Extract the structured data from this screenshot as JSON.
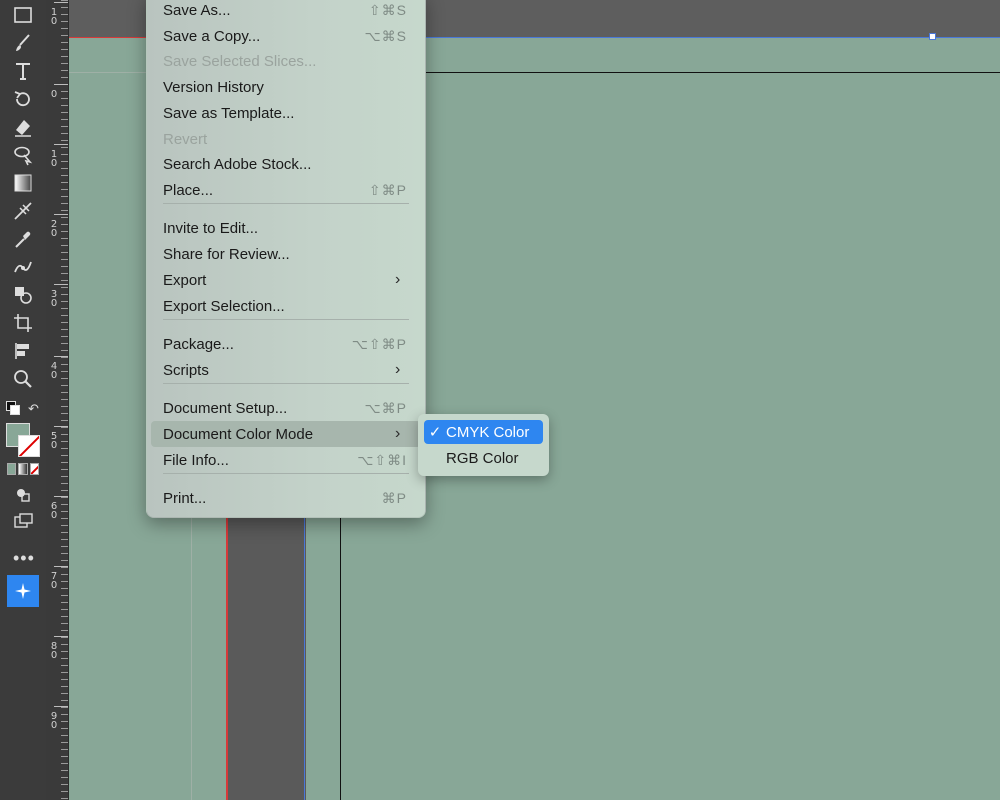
{
  "menu": {
    "items": [
      {
        "label": "Save As...",
        "shortcut": "⇧⌘S",
        "disabled": false,
        "submenu": false
      },
      {
        "label": "Save a Copy...",
        "shortcut": "⌥⌘S",
        "disabled": false,
        "submenu": false
      },
      {
        "label": "Save Selected Slices...",
        "shortcut": "",
        "disabled": true,
        "submenu": false
      },
      {
        "label": "Version History",
        "shortcut": "",
        "disabled": false,
        "submenu": false
      },
      {
        "label": "Save as Template...",
        "shortcut": "",
        "disabled": false,
        "submenu": false
      },
      {
        "label": "Revert",
        "shortcut": "",
        "disabled": true,
        "submenu": false
      },
      {
        "label": "Search Adobe Stock...",
        "shortcut": "",
        "disabled": false,
        "submenu": false
      },
      {
        "label": "Place...",
        "shortcut": "⇧⌘P",
        "disabled": false,
        "submenu": false
      },
      {
        "label": "Invite to Edit...",
        "shortcut": "",
        "disabled": false,
        "submenu": false
      },
      {
        "label": "Share for Review...",
        "shortcut": "",
        "disabled": false,
        "submenu": false
      },
      {
        "label": "Export",
        "shortcut": "",
        "disabled": false,
        "submenu": true
      },
      {
        "label": "Export Selection...",
        "shortcut": "",
        "disabled": false,
        "submenu": false
      },
      {
        "label": "Package...",
        "shortcut": "⌥⇧⌘P",
        "disabled": false,
        "submenu": false
      },
      {
        "label": "Scripts",
        "shortcut": "",
        "disabled": false,
        "submenu": true
      },
      {
        "label": "Document Setup...",
        "shortcut": "⌥⌘P",
        "disabled": false,
        "submenu": false
      },
      {
        "label": "Document Color Mode",
        "shortcut": "",
        "disabled": false,
        "submenu": true
      },
      {
        "label": "File Info...",
        "shortcut": "⌥⇧⌘I",
        "disabled": false,
        "submenu": false
      },
      {
        "label": "Print...",
        "shortcut": "⌘P",
        "disabled": false,
        "submenu": false
      }
    ]
  },
  "submenu": {
    "items": [
      {
        "label": "CMYK Color",
        "checked": true
      },
      {
        "label": "RGB Color",
        "checked": false
      }
    ]
  },
  "ruler": {
    "labels": [
      "1 0",
      "0",
      "1 0",
      "2 0",
      "3 0",
      "4 0",
      "5 0",
      "6 0",
      "7 0",
      "8 0",
      "9 0"
    ]
  },
  "toolbar": {
    "tools": [
      "rectangle-tool-icon",
      "paintbrush-tool-icon",
      "type-tool-icon",
      "rotate-tool-icon",
      "eraser-tool-icon",
      "lasso-tool-icon",
      "gradient-tool-icon",
      "width-tool-icon",
      "eyedropper-tool-icon",
      "puppet-warp-tool-icon",
      "shape-builder-tool-icon",
      "artboard-tool-icon",
      "graph-tool-icon",
      "zoom-tool-icon"
    ]
  },
  "colors": {
    "artboard": "#88a797",
    "fill_swatch": "#88a797",
    "selected_item": "#2e86f0",
    "guide_red": "#d63a3a",
    "guide_blue": "#4a78d8"
  }
}
